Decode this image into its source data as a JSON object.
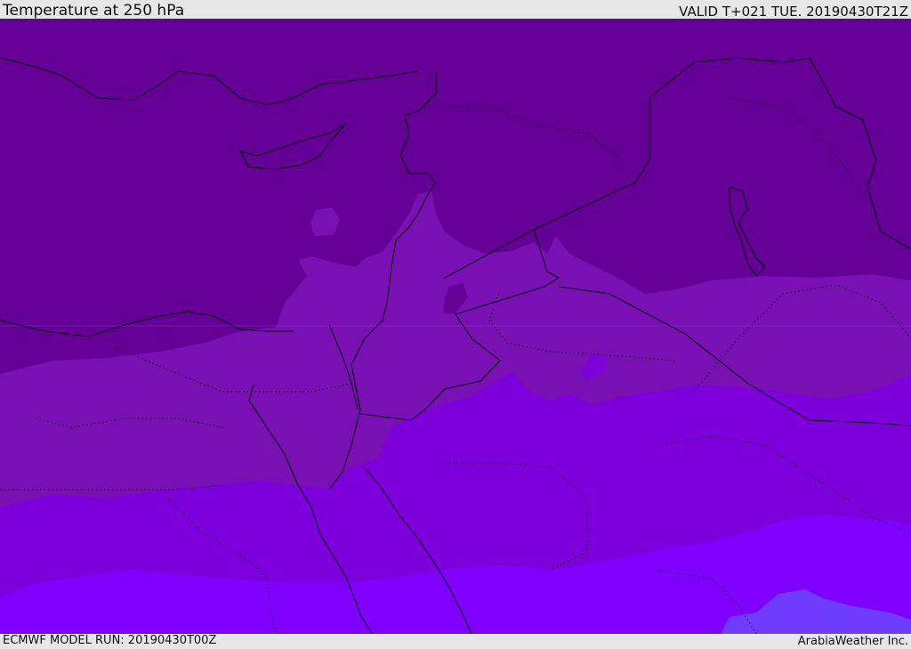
{
  "header": {
    "title": "Temperature at 250 hPa",
    "valid": "VALID T+021 TUE. 20190430T21Z"
  },
  "footer": {
    "model_run": "ECMWF MODEL RUN: 20190430T00Z",
    "credit": "ArabiaWeather Inc."
  },
  "colors": {
    "band_coldest": "#640096",
    "band_cold": "#7810b4",
    "band_mid": "#7d00dc",
    "band_warm": "#7f00ff",
    "band_warmest": "#6e3cff",
    "coastline": "#000000"
  }
}
